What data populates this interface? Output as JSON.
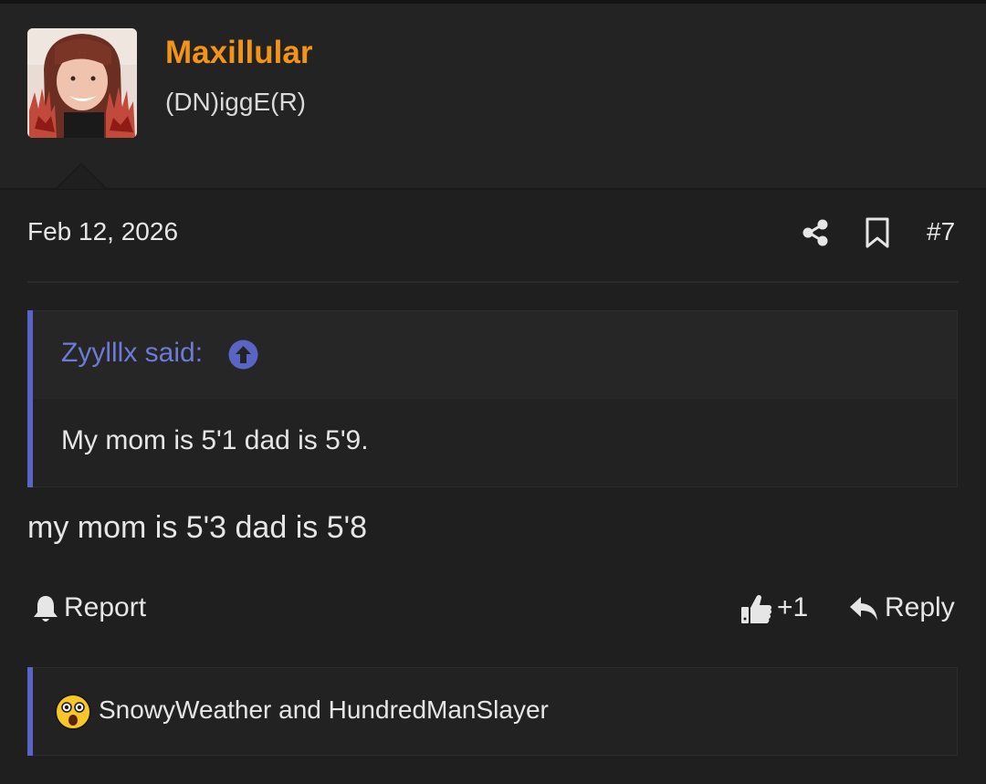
{
  "user": {
    "name": "Maxillular",
    "title": "(DN)iggE(R)",
    "avatar_icon": "avatar-photo"
  },
  "post": {
    "date": "Feb 12, 2026",
    "number": "#7",
    "body": "my mom is 5'3 dad is 5'8"
  },
  "quote": {
    "author": "Zyylllx said:",
    "text": "My mom is 5'1 dad is 5'9."
  },
  "actions": {
    "report": "Report",
    "like_count": "+1",
    "reply": "Reply"
  },
  "reactions": {
    "users": "SnowyWeather and HundredManSlayer",
    "emoji": "astonished-face-icon"
  },
  "colors": {
    "username": "#f39418",
    "quote_accent": "#5964c4",
    "quote_author": "#6d7bd6",
    "background": "#1f1f1f"
  }
}
